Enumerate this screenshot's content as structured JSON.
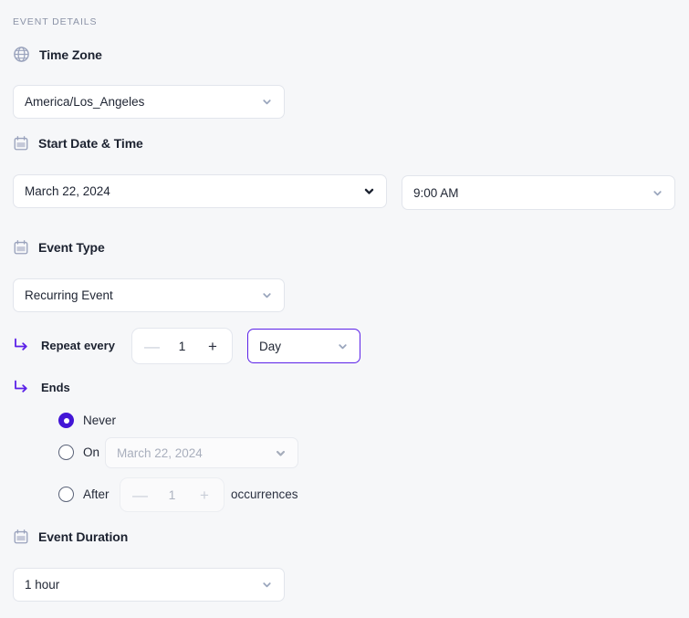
{
  "section": {
    "caption": "EVENT DETAILS"
  },
  "timezone": {
    "icon": "globe-icon",
    "label": "Time Zone",
    "value": "America/Los_Angeles"
  },
  "start": {
    "icon": "calendar-icon",
    "label": "Start Date & Time",
    "date_value": "March 22, 2024",
    "time_value": "9:00 AM"
  },
  "event_type": {
    "icon": "calendar-icon",
    "label": "Event Type",
    "value": "Recurring Event"
  },
  "repeat": {
    "arrow_icon": "corner-down-right-icon",
    "label": "Repeat every",
    "interval_value": "1",
    "decrement_label": "—",
    "increment_label": "+",
    "unit_value": "Day"
  },
  "ends": {
    "arrow_icon": "corner-down-right-icon",
    "label": "Ends",
    "options": [
      {
        "label": "Never",
        "selected": true
      },
      {
        "label": "On",
        "selected": false
      },
      {
        "label": "After",
        "selected": false
      }
    ],
    "on_date_placeholder": "March 22, 2024",
    "after_count_value": "1",
    "after_decrement_label": "—",
    "after_increment_label": "+",
    "after_suffix": "occurrences"
  },
  "duration": {
    "icon": "calendar-icon",
    "label": "Event Duration",
    "value": "1 hour"
  },
  "colors": {
    "background": "#f6f7f9",
    "accent": "#4316d6",
    "focus_ring": "#5b21e8",
    "caption": "#8b93a7",
    "text": "#1e2433"
  }
}
